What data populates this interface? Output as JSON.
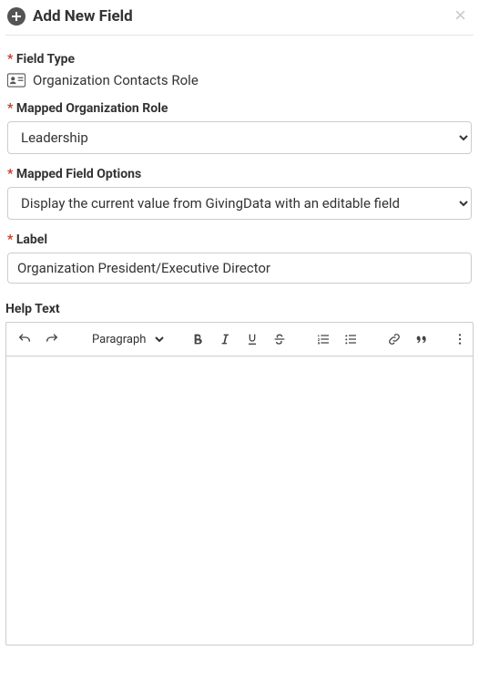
{
  "header": {
    "title": "Add New Field"
  },
  "fieldType": {
    "label": "Field Type",
    "value": "Organization Contacts Role"
  },
  "mappedRole": {
    "label": "Mapped Organization Role",
    "value": "Leadership"
  },
  "mappedOptions": {
    "label": "Mapped Field Options",
    "value": "Display the current value from GivingData with an editable field"
  },
  "labelField": {
    "label": "Label",
    "value": "Organization President/Executive Director"
  },
  "helpText": {
    "label": "Help Text",
    "paragraphOption": "Paragraph",
    "body": ""
  }
}
